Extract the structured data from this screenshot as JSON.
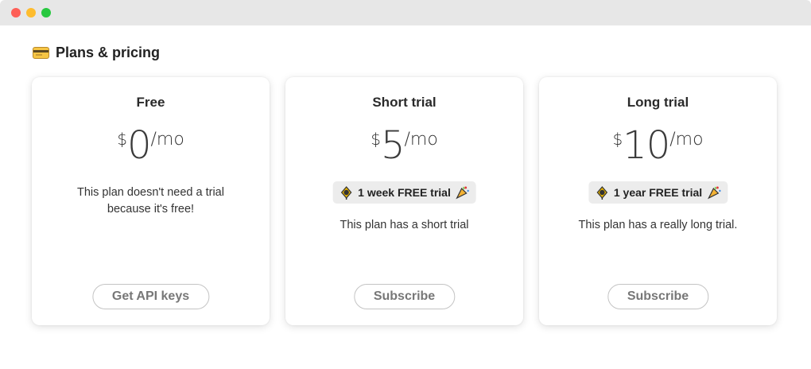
{
  "header": {
    "title": "Plans & pricing",
    "icon": "credit-card-icon"
  },
  "plans": [
    {
      "name": "Free",
      "currency": "$",
      "amount": "0",
      "period": "/mo",
      "badge": null,
      "description": "This plan doesn't need a trial because it's free!",
      "button": "Get API keys"
    },
    {
      "name": "Short trial",
      "currency": "$",
      "amount": "5",
      "period": "/mo",
      "badge": {
        "text": "1 week FREE trial",
        "left_icon": "party-popper-icon",
        "right_icon": "party-horn-icon"
      },
      "description": "This plan has a short trial",
      "button": "Subscribe"
    },
    {
      "name": "Long trial",
      "currency": "$",
      "amount": "10",
      "period": "/mo",
      "badge": {
        "text": "1 year FREE trial",
        "left_icon": "party-popper-icon",
        "right_icon": "party-horn-icon"
      },
      "description": "This plan has a really long trial.",
      "button": "Subscribe"
    }
  ],
  "colors": {
    "badge_bg": "#ececec",
    "button_border": "#c4c4c4",
    "button_text": "#777777"
  }
}
